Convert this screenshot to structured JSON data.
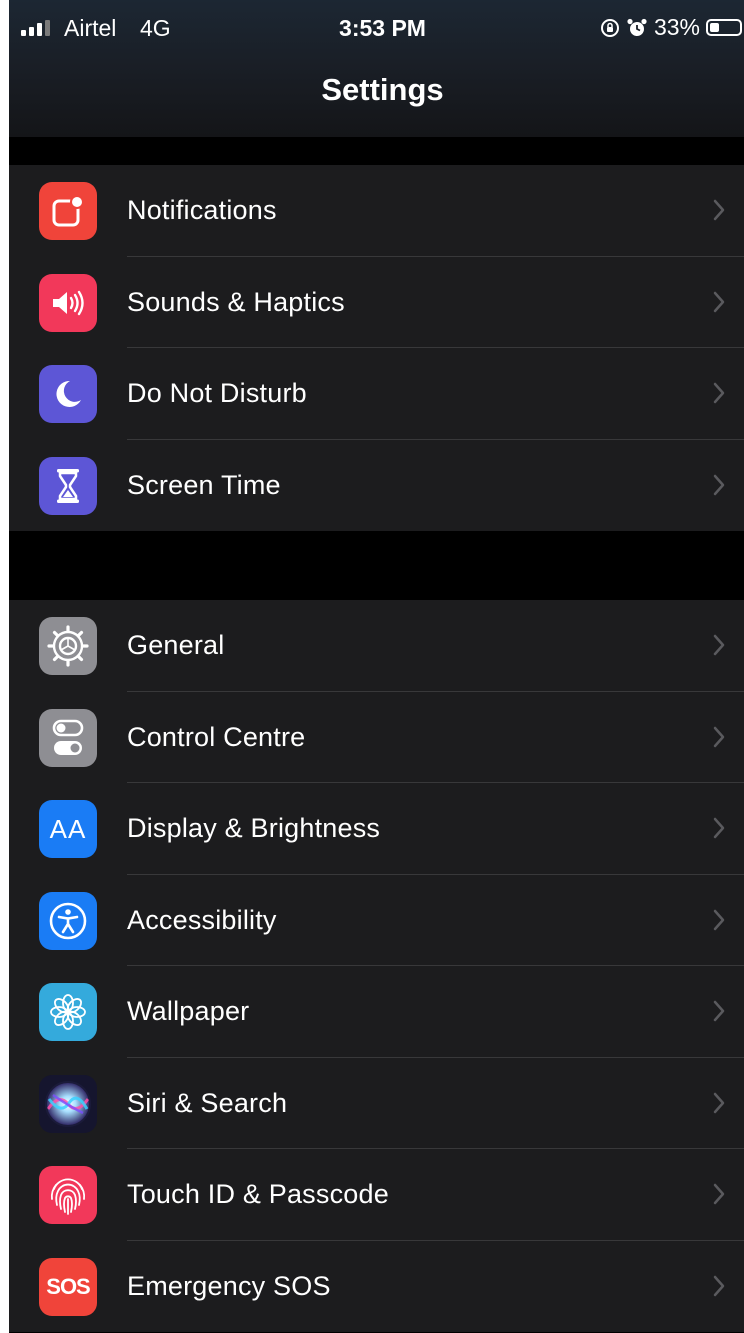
{
  "status_bar": {
    "carrier": "Airtel",
    "network": "4G",
    "time": "3:53 PM",
    "battery_percent": "33%",
    "battery_level": 0.33
  },
  "header": {
    "title": "Settings"
  },
  "groups": [
    {
      "items": [
        {
          "label": "Notifications",
          "icon": "notifications-icon",
          "color": "#f0443a"
        },
        {
          "label": "Sounds & Haptics",
          "icon": "speaker-icon",
          "color": "#f2385a"
        },
        {
          "label": "Do Not Disturb",
          "icon": "moon-icon",
          "color": "#5d56d6"
        },
        {
          "label": "Screen Time",
          "icon": "hourglass-icon",
          "color": "#5d56d6"
        }
      ]
    },
    {
      "items": [
        {
          "label": "General",
          "icon": "gear-icon",
          "color": "#8e8e93"
        },
        {
          "label": "Control Centre",
          "icon": "toggles-icon",
          "color": "#8e8e93"
        },
        {
          "label": "Display & Brightness",
          "icon": "text-size-icon",
          "icon_text": "AA",
          "color": "#1a7cf5"
        },
        {
          "label": "Accessibility",
          "icon": "accessibility-icon",
          "color": "#1a7cf5"
        },
        {
          "label": "Wallpaper",
          "icon": "flower-icon",
          "color": "#34aadc"
        },
        {
          "label": "Siri & Search",
          "icon": "siri-icon",
          "color": "#1b1b3a"
        },
        {
          "label": "Touch ID & Passcode",
          "icon": "fingerprint-icon",
          "color": "#f2385a"
        },
        {
          "label": "Emergency SOS",
          "icon": "sos-icon",
          "icon_text": "SOS",
          "color": "#f0443a"
        }
      ]
    }
  ]
}
